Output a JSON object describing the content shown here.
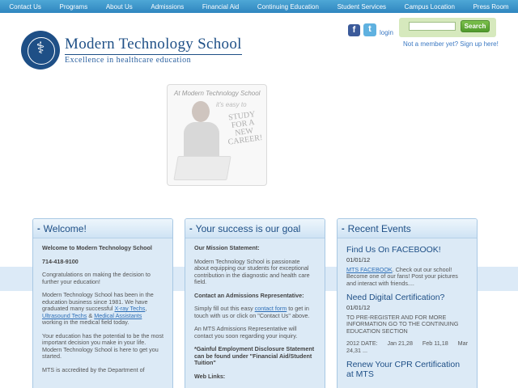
{
  "nav": {
    "items": [
      "Contact Us",
      "Programs",
      "About Us",
      "Admissions",
      "Financial Aid",
      "Continuing Education",
      "Student Services",
      "Campus Location",
      "Press Room"
    ]
  },
  "logo": {
    "name": "Modern Technology School",
    "tagline": "Excellence in healthcare education"
  },
  "social": {
    "facebook_icon": "facebook-icon",
    "twitter_icon": "twitter-icon",
    "login": "login"
  },
  "search": {
    "placeholder": "",
    "button": "Search"
  },
  "member_link": "Not a member yet? Sign up here!",
  "promo": {
    "line1": "At Modern Technology School",
    "line2": "it's easy to",
    "line3": "STUDY",
    "line4": "FOR A",
    "line5": "NEW",
    "line6": "CAREER!"
  },
  "panels": {
    "welcome": {
      "title": "Welcome!",
      "heading": "Welcome to Modern Technology School",
      "phone": "714-418-9100",
      "p1": "Congratulations on making the decision to further your education!",
      "p2_a": "Modern Technology School has been in the education business since 1981. We have graduated many successful ",
      "p2_link1": "X-ray Techs",
      "p2_sep1": ", ",
      "p2_link2": "Ultrasound Techs",
      "p2_sep2": " & ",
      "p2_link3": "Medical Assistants",
      "p2_b": " working in the medical field today.",
      "p3": "Your education has the potential to be the most important decision you make in your life. Modern Technology School is here to get you started.",
      "p4": "MTS is accredited by the Department of"
    },
    "success": {
      "title": "Your success is our goal",
      "mission_label": "Our Mission Statement:",
      "mission": "Modern Technology School is passionate about equipping our students for exceptional contribution in the diagnostic and health care field.",
      "contact_label": "Contact an Admissions Representative:",
      "contact_a": "Simply fill out this easy ",
      "contact_link": "contact form",
      "contact_b": " to get in touch with us or click on \"Contact Us\" above.",
      "rep": "An MTS Admissions Representative will contact you soon regarding your inquiry.",
      "disclosure": "*Gainful Employment Disclosure Statement can be found under \"Financial Aid/Student Tuition\"",
      "web_links": "Web Links:"
    },
    "events": {
      "title": "Recent Events",
      "e1_title": "Find Us On FACEBOOK!",
      "e1_date": "01/01/12",
      "e1_link": "MTS FACEBOOK",
      "e1_text": ". Check out our school! Become one of our fans! Post your pictures and interact with friends....",
      "e2_title": "Need Digital Certification?",
      "e2_date": "01/01/12",
      "e2_text": "TO PRE-REGISTER AND FOR MORE INFORMATION GO TO THE CONTINUING EDUCATION SECTION",
      "e2_dates_a": "2012 DATE:",
      "e2_dates_b": "Jan 21,28",
      "e2_dates_c": "Feb 11,18",
      "e2_dates_d": "Mar",
      "e2_dates_e": "24,31 ...",
      "e3_title": "Renew Your CPR Certification at MTS"
    }
  },
  "colors": {
    "nav_bg": "#3a93c9",
    "brand_blue": "#1e4f86",
    "link_blue": "#2e6fb7",
    "panel_bg": "#dceaf6",
    "search_green": "#5fa836"
  }
}
